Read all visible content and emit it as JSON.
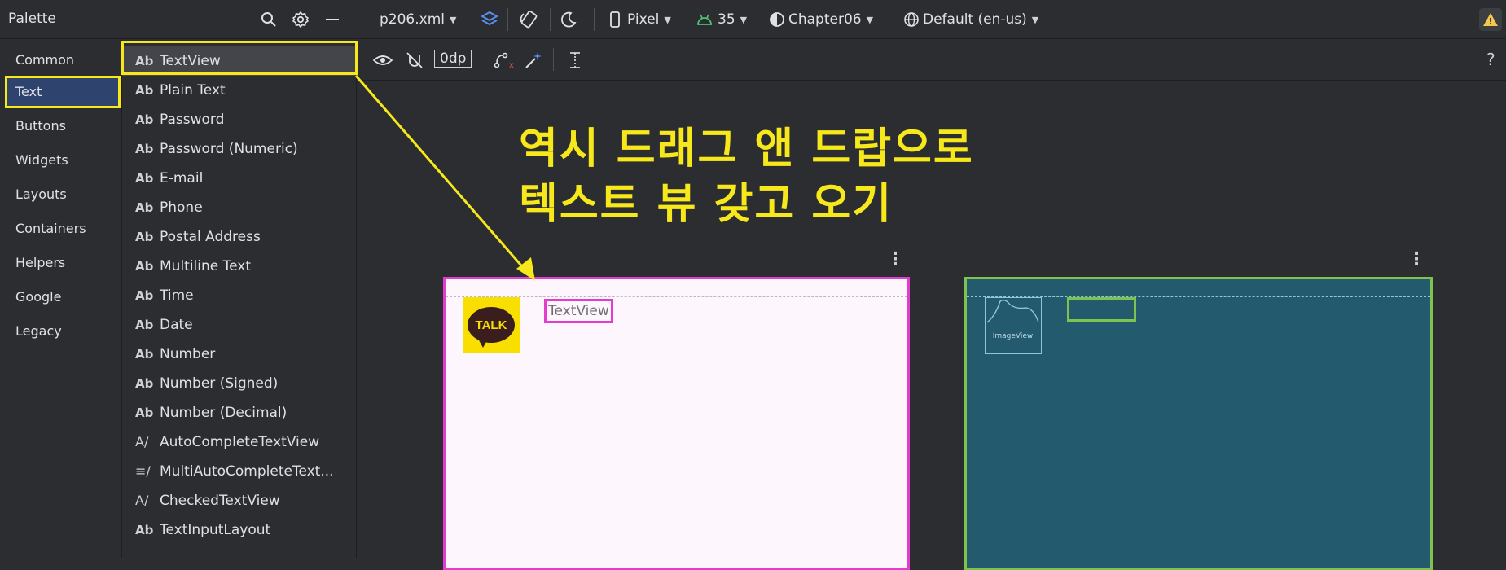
{
  "palette": {
    "title": "Palette",
    "icons": [
      "search-icon",
      "gear-icon",
      "minimize-icon"
    ],
    "categories": [
      "Common",
      "Text",
      "Buttons",
      "Widgets",
      "Layouts",
      "Containers",
      "Helpers",
      "Google",
      "Legacy"
    ],
    "selected_category": "Text",
    "widgets": [
      {
        "icon": "Ab",
        "label": "TextView"
      },
      {
        "icon": "Ab",
        "label": "Plain Text"
      },
      {
        "icon": "Ab",
        "label": "Password"
      },
      {
        "icon": "Ab",
        "label": "Password (Numeric)"
      },
      {
        "icon": "Ab",
        "label": "E-mail"
      },
      {
        "icon": "Ab",
        "label": "Phone"
      },
      {
        "icon": "Ab",
        "label": "Postal Address"
      },
      {
        "icon": "Ab",
        "label": "Multiline Text"
      },
      {
        "icon": "Ab",
        "label": "Time"
      },
      {
        "icon": "Ab",
        "label": "Date"
      },
      {
        "icon": "Ab",
        "label": "Number"
      },
      {
        "icon": "Ab",
        "label": "Number (Signed)"
      },
      {
        "icon": "Ab",
        "label": "Number (Decimal)"
      },
      {
        "icon": "A/",
        "label": "AutoCompleteTextView"
      },
      {
        "icon": "≡/",
        "label": "MultiAutoCompleteText..."
      },
      {
        "icon": "A/",
        "label": "CheckedTextView"
      },
      {
        "icon": "Ab",
        "label": "TextInputLayout"
      }
    ],
    "selected_widget": "TextView"
  },
  "toolbar": {
    "file": "p206.xml",
    "device": "Pixel",
    "api": "35",
    "theme": "Chapter06",
    "locale": "Default (en-us)",
    "margin": "0dp",
    "help": "?",
    "warning": "!"
  },
  "canvas": {
    "annotation_line1": "역시 드래그 앤 드랍으로",
    "annotation_line2": "텍스트 뷰 갖고 오기",
    "talk_logo": "TALK",
    "textview_label": "TextView",
    "imageview_label": "ImageView",
    "more": "⋮"
  },
  "colors": {
    "highlight": "#f6e81a",
    "design_border": "#e43bd1",
    "blueprint_border": "#7ec34e",
    "blueprint_bg": "#245a6e",
    "selected_category_bg": "#2e436e"
  }
}
